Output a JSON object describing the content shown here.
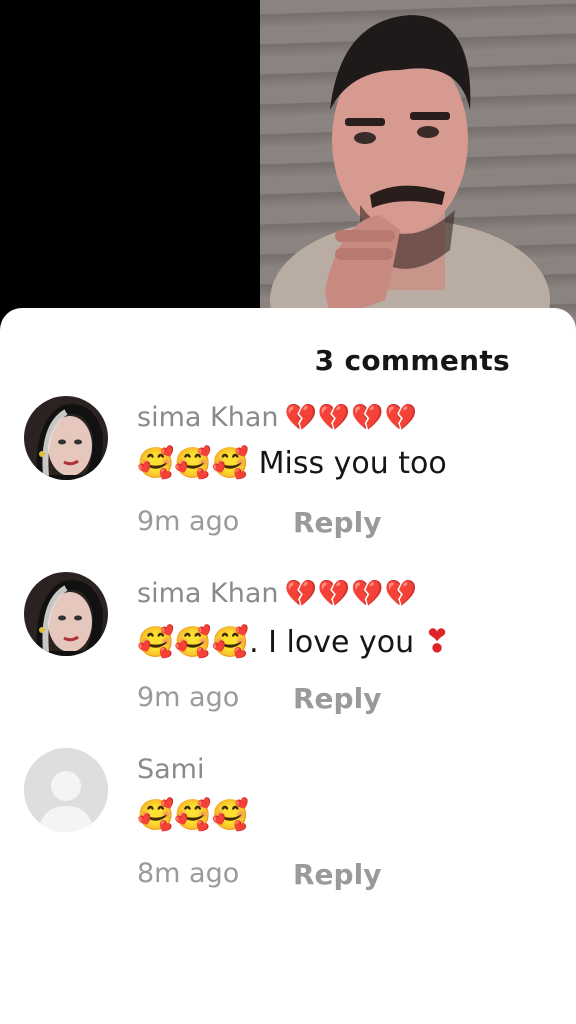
{
  "sheet": {
    "title": "3 comments"
  },
  "comments": [
    {
      "username": "sima Khan",
      "name_suffix": "💔💔💔💔",
      "emoji": "🥰🥰🥰",
      "text": "Miss you too",
      "time": "9m ago",
      "reply_label": "Reply",
      "avatar": "profile-photo"
    },
    {
      "username": "sima Khan",
      "name_suffix": "💔💔💔💔",
      "emoji": "🥰🥰🥰",
      "text": ". I love you",
      "text_suffix": "❣",
      "time": "9m ago",
      "reply_label": "Reply",
      "avatar": "profile-photo"
    },
    {
      "username": "Sami",
      "emoji": "🥰🥰🥰",
      "text": "",
      "time": "8m ago",
      "reply_label": "Reply",
      "avatar": "default-avatar"
    }
  ],
  "colors": {
    "background": "#000000",
    "sheet": "#ffffff",
    "muted_text": "#8a8a8a",
    "heart_pink": "#f3a3b2",
    "heart_red": "#e0222b"
  }
}
